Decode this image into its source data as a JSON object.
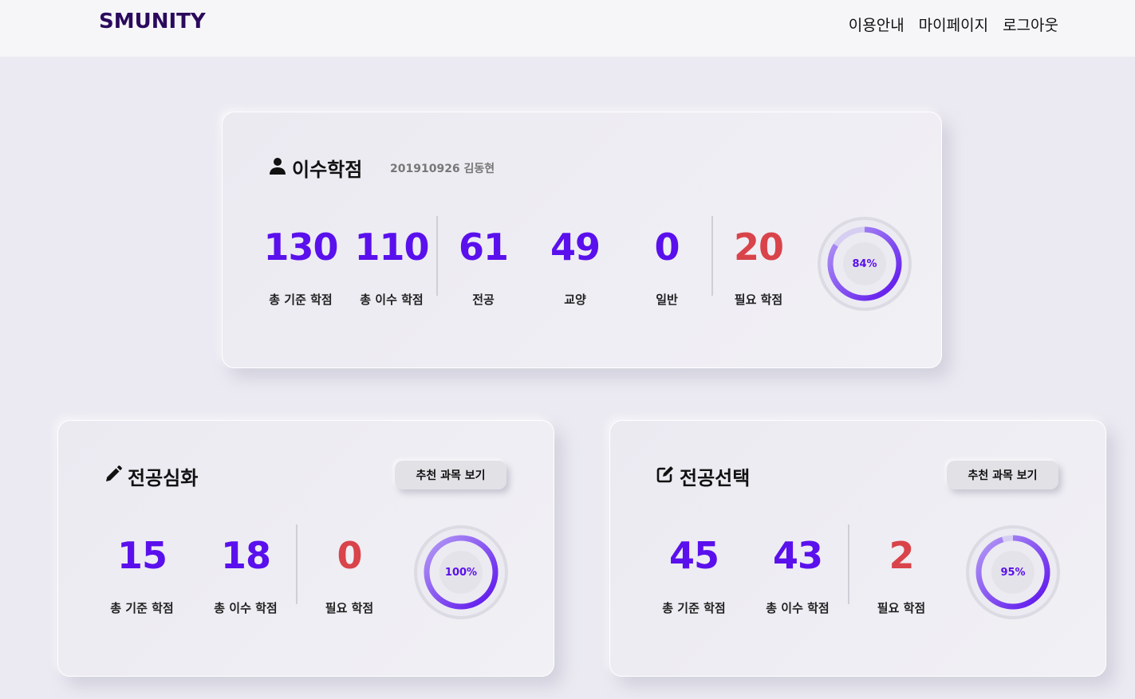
{
  "header": {
    "logo": "SMUNITY",
    "nav": [
      "이용안내",
      "마이페이지",
      "로그아웃"
    ]
  },
  "colors": {
    "accent": "#5a10ec",
    "alert": "#d9434a",
    "logo": "#2b0a5c"
  },
  "credits": {
    "title": "이수학점",
    "icon": "user-icon",
    "student": "201910926 김동현",
    "stats": [
      {
        "value": "130",
        "label": "총 기준 학점"
      },
      {
        "value": "110",
        "label": "총 이수 학점"
      },
      {
        "value": "61",
        "label": "전공"
      },
      {
        "value": "49",
        "label": "교양"
      },
      {
        "value": "0",
        "label": "일반"
      },
      {
        "value": "20",
        "label": "필요 학점"
      }
    ],
    "percent": 84,
    "percent_label": "84%"
  },
  "major_advanced": {
    "title": "전공심화",
    "icon": "pencil-icon",
    "button": "추천 과목 보기",
    "stats": [
      {
        "value": "15",
        "label": "총 기준 학점"
      },
      {
        "value": "18",
        "label": "총 이수 학점"
      },
      {
        "value": "0",
        "label": "필요 학점"
      }
    ],
    "percent": 100,
    "percent_label": "100%"
  },
  "major_elective": {
    "title": "전공선택",
    "icon": "edit-icon",
    "button": "추천 과목 보기",
    "stats": [
      {
        "value": "45",
        "label": "총 기준 학점"
      },
      {
        "value": "43",
        "label": "총 이수 학점"
      },
      {
        "value": "2",
        "label": "필요 학점"
      }
    ],
    "percent": 95,
    "percent_label": "95%"
  }
}
